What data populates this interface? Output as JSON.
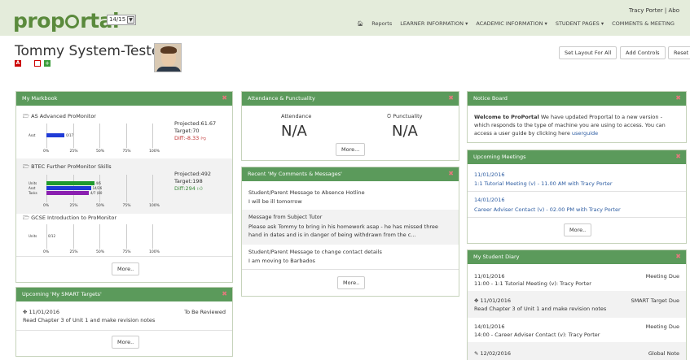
{
  "app": {
    "logo": "proportal",
    "year": "14/15",
    "user": "Tracy Porter | Abo"
  },
  "nav": [
    "Reports",
    "LEARNER INFORMATION ▾",
    "ACADEMIC INFORMATION ▾",
    "STUDENT PAGES ▾",
    "COMMENTS & MEETING"
  ],
  "student": {
    "name": "Tommy System-Tester"
  },
  "buttons": {
    "set_layout": "Set Layout For All",
    "add_controls": "Add Controls",
    "reset": "Reset"
  },
  "markbook": {
    "title": "My Markbook",
    "items": [
      {
        "title": "AS Advanced ProMonitor",
        "projected": "Projected:61.67",
        "target": "Target:70",
        "diff": "Diff:-8.33"
      },
      {
        "title": "BTEC Further ProMonitor Skills",
        "projected": "Projected:492",
        "target": "Target:198",
        "diff": "Diff:294"
      },
      {
        "title": "GCSE Introduction to ProMonitor",
        "projected": "",
        "target": "",
        "diff": ""
      }
    ],
    "more": "More.."
  },
  "chart_data": [
    {
      "type": "bar",
      "categories": [
        "Asst"
      ],
      "values": [
        17
      ],
      "data_labels": [
        "0/17"
      ],
      "xlim": [
        0,
        100
      ],
      "xticks": [
        "0%",
        "25%",
        "50%",
        "75%",
        "100%"
      ],
      "colors": [
        "#1f3bd6"
      ]
    },
    {
      "type": "bar",
      "categories": [
        "Units",
        "Asst",
        "Tasks"
      ],
      "values": [
        45,
        42,
        40
      ],
      "data_labels": [
        "4/6",
        "14/26",
        "4/7 (80"
      ],
      "xlim": [
        0,
        100
      ],
      "xticks": [
        "0%",
        "25%",
        "50%",
        "75%",
        "100%"
      ],
      "colors": [
        "#1f9a2e",
        "#1f3bd6",
        "#8a1fb0"
      ]
    },
    {
      "type": "bar",
      "categories": [
        "Units"
      ],
      "values": [
        0
      ],
      "data_labels": [
        "0/12"
      ],
      "xlim": [
        0,
        100
      ],
      "xticks": [
        "0%",
        "25%",
        "50%",
        "75%",
        "100%"
      ],
      "colors": [
        "#1f9a2e"
      ]
    }
  ],
  "smart": {
    "title": "Upcoming 'My SMART Targets'",
    "date": "11/01/2016",
    "status": "To Be Reviewed",
    "text": "Read Chapter 3 of Unit 1 and make revision notes",
    "more": "More.."
  },
  "attendance": {
    "title": "Attendance & Punctuality",
    "att_label": "Attendance",
    "punc_label": "Punctuality",
    "att_value": "N/A",
    "punc_value": "N/A",
    "more": "More..."
  },
  "comments": {
    "title": "Recent 'My Comments & Messages'",
    "items": [
      {
        "head": "Student/Parent Message to Absence Hotline",
        "body1": "I will be ill tomorrow",
        "body2": ""
      },
      {
        "head": "Message from Subject Tutor",
        "body1": "Please ask Tommy to bring in his homework asap - he has missed three",
        "body2": "hand in dates and is in danger of being withdrawn from the c..."
      },
      {
        "head": "Student/Parent Message to change contact details",
        "body1": "I am moving to Barbados",
        "body2": ""
      }
    ],
    "more": "More.."
  },
  "notice": {
    "title": "Notice Board",
    "bold": "Welcome to ProPortal",
    "line1": "We have updated Proportal to a new version -",
    "line2": "which responds to the type of machine you are using to access. You can",
    "line3": "access a user guide by clicking here",
    "link": "userguide"
  },
  "meetings": {
    "title": "Upcoming Meetings",
    "items": [
      {
        "date": "11/01/2016",
        "text": "1:1 Tutorial Meeting (v) - 11.00 AM with Tracy Porter"
      },
      {
        "date": "14/01/2016",
        "text": "Career Adviser Contact (v) - 02.00 PM with Tracy Porter"
      }
    ],
    "more": "More.."
  },
  "diary": {
    "title": "My Student Diary",
    "items": [
      {
        "date": "11/01/2016",
        "type": "Meeting Due",
        "text": "11:00 - 1:1 Tutorial Meeting (v): Tracy Porter"
      },
      {
        "date": "11/01/2016",
        "type": "SMART Target Due",
        "text": "Read Chapter 3 of Unit 1 and make revision notes"
      },
      {
        "date": "14/01/2016",
        "type": "Meeting Due",
        "text": "14:00 - Career Adviser Contact (v): Tracy Porter"
      },
      {
        "date": "12/02/2016",
        "type": "Global Note",
        "text": ""
      }
    ]
  }
}
